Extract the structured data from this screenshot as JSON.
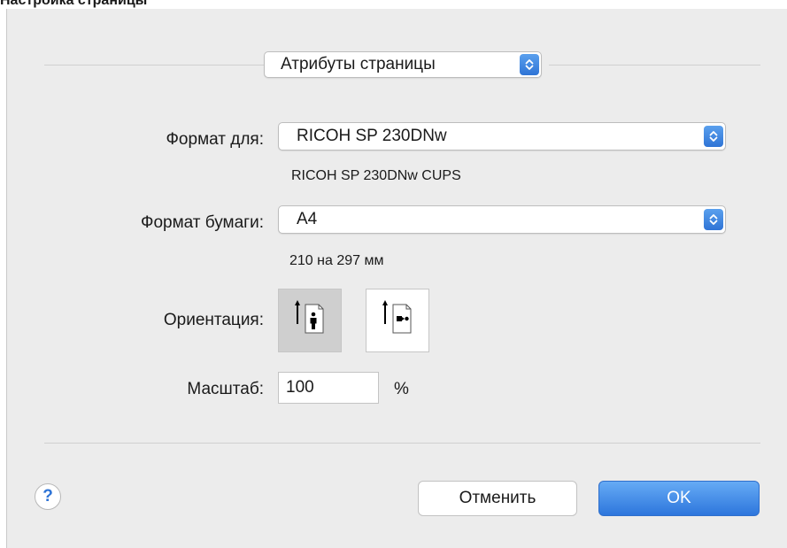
{
  "window": {
    "title": "Настройка страницы"
  },
  "settings_menu": {
    "value": "Атрибуты страницы"
  },
  "format_for": {
    "label": "Формат для:",
    "value": "RICOH SP 230DNw",
    "description": "RICOH SP 230DNw CUPS"
  },
  "paper_size": {
    "label": "Формат бумаги:",
    "value": "A4",
    "description": "210 на 297 мм"
  },
  "orientation": {
    "label": "Ориентация:",
    "options": [
      "portrait",
      "landscape"
    ],
    "selected": "portrait"
  },
  "scale": {
    "label": "Масштаб:",
    "value": "100",
    "unit": "%"
  },
  "buttons": {
    "help": "?",
    "cancel": "Отменить",
    "ok": "OK"
  },
  "colors": {
    "accent": "#2f74d6",
    "sheet_bg": "#ececec"
  }
}
